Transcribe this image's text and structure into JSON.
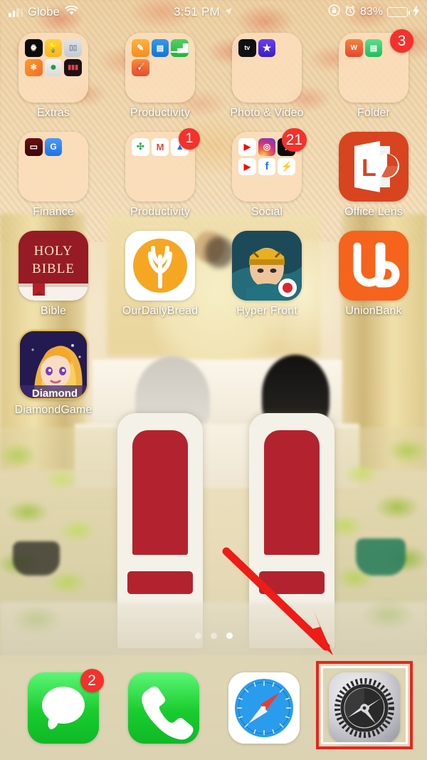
{
  "status_bar": {
    "signal_icon": "signal-bars-icon",
    "carrier": "Globe",
    "wifi_icon": "wifi-icon",
    "time": "3:51 PM",
    "location_icon": "location-arrow-icon",
    "rotation_lock_icon": "rotation-lock-icon",
    "alarm_icon": "alarm-clock-icon",
    "battery_percent": "83%",
    "battery_icon": "battery-icon",
    "charging_icon": "lightning-bolt-icon",
    "battery_level": 83,
    "battery_color": "#3ad24a"
  },
  "home_screen": {
    "rows": [
      [
        {
          "name": "Extras",
          "type": "folder",
          "badge": null,
          "mini_apps": [
            {
              "label": "Watch",
              "icon": "watch-icon"
            },
            {
              "label": "Tips",
              "icon": "tips-lightbulb-icon"
            },
            {
              "label": "Measure",
              "icon": "measure-ruler-icon"
            },
            {
              "label": "Shortcuts",
              "icon": "shortcuts-icon"
            },
            {
              "label": "Compass",
              "icon": "compass-icon"
            },
            {
              "label": "Voice Memos",
              "icon": "voice-memos-icon"
            }
          ]
        },
        {
          "name": "Productivity",
          "type": "folder",
          "badge": null,
          "mini_apps": [
            {
              "label": "Pages",
              "icon": "pages-icon"
            },
            {
              "label": "Keynote",
              "icon": "keynote-icon"
            },
            {
              "label": "Numbers",
              "icon": "numbers-icon"
            },
            {
              "label": "GarageBand",
              "icon": "garageband-icon"
            }
          ]
        },
        {
          "name": "Photo & Video",
          "type": "folder",
          "badge": null,
          "mini_apps": [
            {
              "label": "Apple TV",
              "icon": "apple-tv-icon"
            },
            {
              "label": "iMovie",
              "icon": "imovie-star-icon"
            }
          ]
        },
        {
          "name": "Folder",
          "type": "folder",
          "badge": "3",
          "mini_apps": [
            {
              "label": "Word",
              "icon": "word-icon"
            },
            {
              "label": "Notes",
              "icon": "notes-icon"
            }
          ]
        }
      ],
      [
        {
          "name": "Finance",
          "type": "folder",
          "badge": null,
          "mini_apps": [
            {
              "label": "Wallet",
              "icon": "wallet-icon"
            },
            {
              "label": "GCash",
              "icon": "g-app-icon"
            }
          ]
        },
        {
          "name": "Productivity",
          "type": "folder",
          "badge": "1",
          "mini_apps": [
            {
              "label": "Google Photos",
              "icon": "google-photos-icon"
            },
            {
              "label": "Gmail",
              "icon": "gmail-icon"
            },
            {
              "label": "Google Drive",
              "icon": "google-drive-icon"
            }
          ]
        },
        {
          "name": "Social",
          "type": "folder",
          "badge": "21",
          "mini_apps": [
            {
              "label": "YouTube",
              "icon": "youtube-icon"
            },
            {
              "label": "Instagram",
              "icon": "instagram-icon"
            },
            {
              "label": "TikTok",
              "icon": "tiktok-icon"
            },
            {
              "label": "YouTube Music",
              "icon": "youtube-music-icon"
            },
            {
              "label": "Facebook",
              "icon": "facebook-icon"
            },
            {
              "label": "Messenger",
              "icon": "messenger-icon"
            }
          ]
        },
        {
          "name": "Office Lens",
          "type": "app",
          "badge": null,
          "icon": "office-lens-icon"
        }
      ],
      [
        {
          "name": "Bible",
          "type": "app",
          "badge": null,
          "icon": "holy-bible-icon",
          "icon_text": [
            "HOLY",
            "BIBLE"
          ]
        },
        {
          "name": "OurDailyBread",
          "type": "app",
          "badge": null,
          "icon": "our-daily-bread-icon"
        },
        {
          "name": "Hyper Front",
          "type": "app",
          "badge": null,
          "icon": "hyper-front-icon"
        },
        {
          "name": "UnionBank",
          "type": "app",
          "badge": null,
          "icon": "unionbank-icon",
          "icon_text": "UB"
        }
      ],
      [
        {
          "name": "DiamondGame",
          "type": "app",
          "badge": null,
          "icon": "diamond-game-icon",
          "icon_text": "Diamond"
        }
      ]
    ]
  },
  "page_indicator": {
    "total_pages": 3,
    "active_page": 3
  },
  "dock": {
    "apps": [
      {
        "name": "Messages",
        "icon": "messages-icon",
        "badge": "2"
      },
      {
        "name": "Phone",
        "icon": "phone-icon",
        "badge": null
      },
      {
        "name": "Safari",
        "icon": "safari-compass-icon",
        "badge": null
      },
      {
        "name": "Settings",
        "icon": "settings-gear-icon",
        "badge": null,
        "highlighted": true
      }
    ]
  },
  "annotation": {
    "arrow": {
      "icon": "red-arrow-icon",
      "color": "#ee1c16",
      "points_to": "Settings"
    },
    "highlight_box": {
      "color": "#e8251c",
      "target": "Settings"
    }
  }
}
